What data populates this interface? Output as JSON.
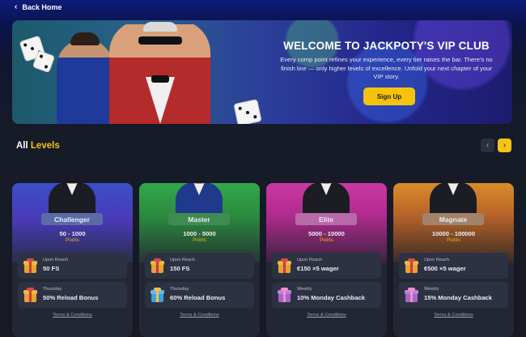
{
  "nav": {
    "back_label": "Back Home"
  },
  "banner": {
    "title": "WELCOME TO JACKPOTY'S VIP CLUB",
    "text": "Every comp point refines your experience, every tier raises the bar. There's no finish line — only higher levels of excellence. Unfold your next chapter of your VIP story.",
    "signup_label": "Sign Up"
  },
  "levels": {
    "heading_white": "All",
    "heading_accent": "Levels",
    "accent_color": "#f6c414",
    "cards": [
      {
        "name": "Challenger",
        "range": "50 - 1000",
        "points_label": "Points",
        "perk1_label": "Upon Reach",
        "perk1_value": "50 FS",
        "perk2_label": "Thursday",
        "perk2_value": "50% Reload Bonus",
        "terms": "Terms & Conditions"
      },
      {
        "name": "Master",
        "range": "1000 - 5000",
        "points_label": "Points",
        "perk1_label": "Upon Reach",
        "perk1_value": "150 FS",
        "perk2_label": "Thursday",
        "perk2_value": "60% Reload Bonus",
        "terms": "Terms & Conditions"
      },
      {
        "name": "Elite",
        "range": "5000 - 10000",
        "points_label": "Points",
        "perk1_label": "Upon Reach",
        "perk1_value": "€150 ×5 wager",
        "perk2_label": "Weekly",
        "perk2_value": "10% Monday Cashback",
        "terms": "Terms & Conditions"
      },
      {
        "name": "Magnate",
        "range": "10000 - 100000",
        "points_label": "Points",
        "perk1_label": "Upon Reach",
        "perk1_value": "€500 ×5 wager",
        "perk2_label": "Weekly",
        "perk2_value": "15% Monday Cashback",
        "terms": "Terms & Conditions"
      }
    ]
  }
}
